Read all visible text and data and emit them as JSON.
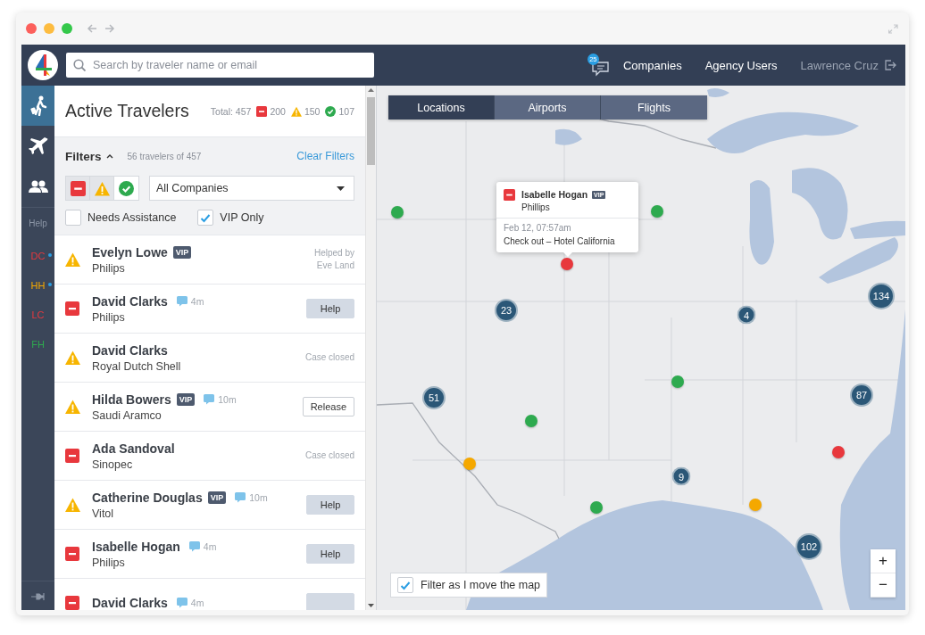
{
  "topbar": {
    "search": {
      "placeholder": "Search by traveler name or email"
    },
    "messages_badge": "25",
    "links": [
      "Companies",
      "Agency Users"
    ],
    "user": "Lawrence Cruz"
  },
  "sidebar": {
    "items": [
      {
        "kind": "travelers",
        "selected": true
      },
      {
        "kind": "flights",
        "selected": false
      },
      {
        "kind": "people",
        "selected": false
      }
    ],
    "help": "Help",
    "agents": [
      {
        "label": "DC",
        "color": "#e8383d",
        "online": true
      },
      {
        "label": "HH",
        "color": "#f5a800",
        "online": true
      },
      {
        "label": "LC",
        "color": "#e8383d",
        "online": false
      },
      {
        "label": "FH",
        "color": "#2eaa4f",
        "online": false
      }
    ]
  },
  "panel": {
    "title": "Active Travelers",
    "total": "Total: 457",
    "counts": [
      {
        "kind": "danger",
        "count": "200"
      },
      {
        "kind": "warning",
        "count": "150"
      },
      {
        "kind": "ok",
        "count": "107"
      }
    ],
    "filters": {
      "label": "Filters",
      "expanded": true,
      "summary": "56 travelers of 457",
      "clear": "Clear Filters",
      "status_toggles": [
        {
          "kind": "danger",
          "selected": true
        },
        {
          "kind": "warning",
          "selected": true
        },
        {
          "kind": "ok",
          "selected": false
        }
      ],
      "company_select": "All Companies",
      "checkboxes": [
        {
          "label": "Needs Assistance",
          "checked": false
        },
        {
          "label": "VIP Only",
          "checked": true
        }
      ]
    },
    "travelers": [
      {
        "kind": "warning",
        "name": "Evelyn Lowe",
        "badge": "VIP",
        "company": "Philips",
        "action": {
          "kind": "note",
          "text": "Helped by Eve Land"
        }
      },
      {
        "kind": "danger",
        "name": "David Clarks",
        "message_age": "4m",
        "company": "Philips",
        "action": {
          "kind": "button",
          "label": "Help"
        }
      },
      {
        "kind": "warning",
        "name": "David Clarks",
        "company": "Royal Dutch Shell",
        "action": {
          "kind": "note",
          "text": "Case closed"
        }
      },
      {
        "kind": "warning",
        "name": "Hilda Bowers",
        "badge": "VIP",
        "message_age": "10m",
        "company": "Saudi Aramco",
        "action": {
          "kind": "outlinebutton",
          "label": "Release"
        }
      },
      {
        "kind": "danger",
        "name": "Ada Sandoval",
        "company": "Sinopec",
        "action": {
          "kind": "note",
          "text": "Case closed"
        }
      },
      {
        "kind": "warning",
        "name": "Catherine Douglas",
        "badge": "VIP",
        "message_age": "10m",
        "company": "Vitol",
        "action": {
          "kind": "button",
          "label": "Help"
        }
      },
      {
        "kind": "danger",
        "name": "Isabelle Hogan",
        "message_age": "4m",
        "company": "Philips",
        "action": {
          "kind": "button",
          "label": "Help"
        }
      },
      {
        "kind": "danger",
        "name": "David Clarks",
        "message_age": "4m",
        "action": {
          "kind": "button"
        }
      }
    ]
  },
  "map": {
    "kind": "picture",
    "tabs": [
      {
        "label": "Locations",
        "selected": true
      },
      {
        "label": "Airports",
        "selected": false
      },
      {
        "label": "Flights",
        "selected": false
      }
    ],
    "markers": [
      {
        "kind": "dot",
        "color": "#2eaa4f"
      },
      {
        "kind": "dot",
        "color": "#2eaa4f"
      },
      {
        "kind": "dot",
        "color": "#e8383d"
      },
      {
        "kind": "cluster",
        "count": "134"
      },
      {
        "kind": "cluster",
        "count": "23"
      },
      {
        "kind": "cluster",
        "count": "4"
      },
      {
        "kind": "dot",
        "color": "#2eaa4f"
      },
      {
        "kind": "cluster",
        "count": "51"
      },
      {
        "kind": "cluster",
        "count": "87"
      },
      {
        "kind": "dot",
        "color": "#2eaa4f"
      },
      {
        "kind": "dot",
        "color": "#e8383d"
      },
      {
        "kind": "dot",
        "color": "#f5a800"
      },
      {
        "kind": "cluster",
        "count": "9"
      },
      {
        "kind": "dot",
        "color": "#2eaa4f"
      },
      {
        "kind": "dot",
        "color": "#f5a800"
      },
      {
        "kind": "cluster",
        "count": "102"
      }
    ],
    "tooltip": {
      "kind": "danger",
      "name": "Isabelle Hogan",
      "badge": "VIP",
      "company": "Phillips",
      "time": "Feb 12, 07:57am",
      "event": "Check out – Hotel California"
    },
    "filter_checkbox": {
      "label": "Filter as I move the map",
      "checked": true
    },
    "zoom": [
      "+",
      "−"
    ]
  }
}
